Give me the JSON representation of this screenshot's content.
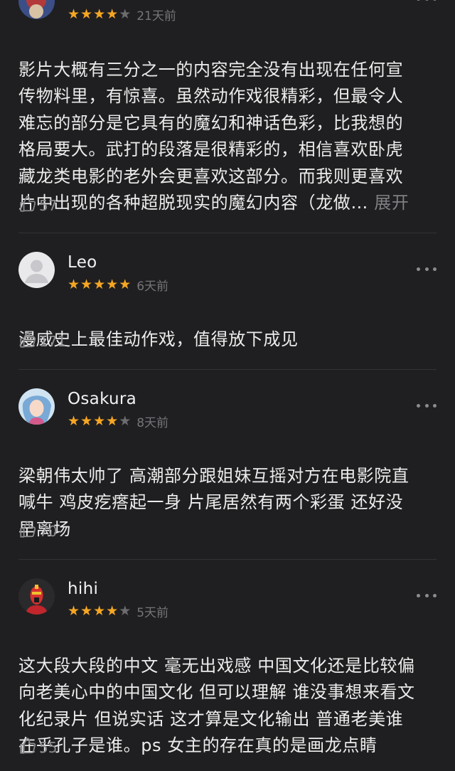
{
  "reviews": [
    {
      "username": "",
      "stars": 4,
      "date": "21天前",
      "text_lines": [
        "影片大概有三分之一的内容完全没有出现在任何宣",
        "传物料里，有惊喜。虽然动作戏很精彩，但最令人",
        "难忘的部分是它具有的魔幻和神话色彩，比我想的",
        "格局要大。武打的段落是很精彩的，相信喜欢卧虎",
        "藏龙类电影的老外会更喜欢这部分。而我则更喜欢",
        "片中出现的各种超脱现实的魔幻内容（龙做… "
      ],
      "expand_label": "展开",
      "likes": "57"
    },
    {
      "username": "Leo",
      "stars": 5,
      "date": "6天前",
      "text_lines": [
        "漫威史上最佳动作戏，值得放下成见"
      ],
      "likes": "171"
    },
    {
      "username": "Osakura",
      "stars": 4,
      "date": "8天前",
      "text_lines": [
        "梁朝伟太帅了 高潮部分跟姐妹互摇对方在电影院直",
        "喊牛 鸡皮疙瘩起一身 片尾居然有两个彩蛋 还好没",
        "早离场"
      ],
      "likes": "70"
    },
    {
      "username": "hihi",
      "stars": 4,
      "date": "5天前",
      "text_lines": [
        "这大段大段的中文 毫无出戏感 中国文化还是比较偏",
        "向老美心中的中国文化 但可以理解 谁没事想来看文",
        "化纪录片 但说实话 这才算是文化输出 普通老美谁",
        "在乎孔子是谁。ps 女主的存在真的是画龙点睛"
      ],
      "likes": "55"
    }
  ],
  "colors": {
    "background": "#1f1f21",
    "star_on": "#f5a623",
    "star_off": "#6c6c70",
    "muted": "#8c8c90"
  },
  "icons": {
    "rating": "star-icon",
    "menu": "more-dots-icon",
    "like": "thumbs-up-icon"
  }
}
